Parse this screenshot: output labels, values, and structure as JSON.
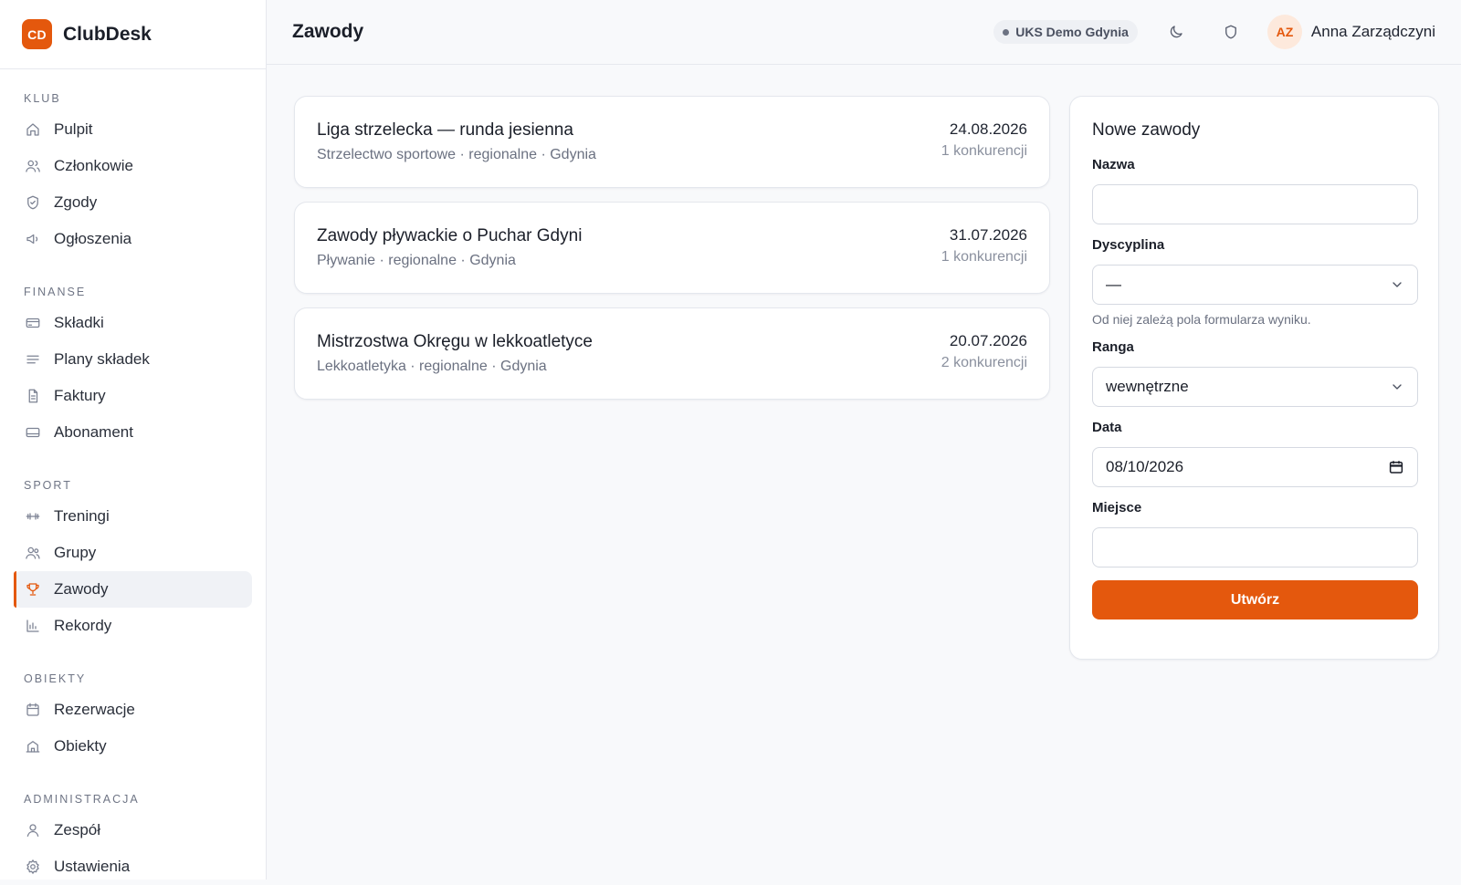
{
  "brand": {
    "logo": "CD",
    "name": "ClubDesk"
  },
  "sidebar": {
    "sections": [
      {
        "title": "KLUB",
        "items": [
          {
            "label": "Pulpit",
            "icon": "home-icon"
          },
          {
            "label": "Członkowie",
            "icon": "users-icon"
          },
          {
            "label": "Zgody",
            "icon": "shield-check-icon"
          },
          {
            "label": "Ogłoszenia",
            "icon": "megaphone-icon"
          }
        ]
      },
      {
        "title": "FINANSE",
        "items": [
          {
            "label": "Składki",
            "icon": "credit-card-icon"
          },
          {
            "label": "Plany składek",
            "icon": "list-icon"
          },
          {
            "label": "Faktury",
            "icon": "document-icon"
          },
          {
            "label": "Abonament",
            "icon": "card-icon"
          }
        ]
      },
      {
        "title": "SPORT",
        "items": [
          {
            "label": "Treningi",
            "icon": "dumbbell-icon"
          },
          {
            "label": "Grupy",
            "icon": "group-icon"
          },
          {
            "label": "Zawody",
            "icon": "trophy-icon",
            "active": true
          },
          {
            "label": "Rekordy",
            "icon": "bar-chart-icon"
          }
        ]
      },
      {
        "title": "OBIEKTY",
        "items": [
          {
            "label": "Rezerwacje",
            "icon": "calendar-icon"
          },
          {
            "label": "Obiekty",
            "icon": "building-icon"
          }
        ]
      },
      {
        "title": "ADMINISTRACJA",
        "items": [
          {
            "label": "Zespół",
            "icon": "user-icon"
          },
          {
            "label": "Ustawienia",
            "icon": "gear-icon"
          }
        ]
      }
    ]
  },
  "header": {
    "title": "Zawody",
    "club": "UKS Demo Gdynia",
    "avatar": "AZ",
    "user": "Anna Zarządczyni"
  },
  "competitions": [
    {
      "name": "Liga strzelecka — runda jesienna",
      "meta": "Strzelectwo sportowe · regionalne · Gdynia",
      "date": "24.08.2026",
      "count": "1 konkurencji"
    },
    {
      "name": "Zawody pływackie o Puchar Gdyni",
      "meta": "Pływanie · regionalne · Gdynia",
      "date": "31.07.2026",
      "count": "1 konkurencji"
    },
    {
      "name": "Mistrzostwa Okręgu w lekkoatletyce",
      "meta": "Lekkoatletyka · regionalne · Gdynia",
      "date": "20.07.2026",
      "count": "2 konkurencji"
    }
  ],
  "form": {
    "title": "Nowe zawody",
    "name_label": "Nazwa",
    "name_value": "",
    "discipline_label": "Dyscyplina",
    "discipline_value": "—",
    "discipline_hint": "Od niej zależą pola formularza wyniku.",
    "rank_label": "Ranga",
    "rank_value": "wewnętrzne",
    "date_label": "Data",
    "date_value": "08/10/2026",
    "place_label": "Miejsce",
    "place_value": "",
    "submit_label": "Utwórz"
  },
  "colors": {
    "accent": "#e4580d",
    "background": "#f8f9fb"
  }
}
